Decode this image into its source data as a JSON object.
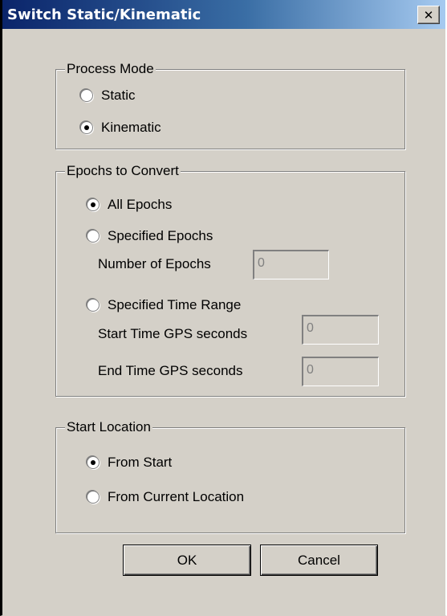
{
  "window": {
    "title": "Switch Static/Kinematic",
    "close_glyph": "✕"
  },
  "process_mode": {
    "legend": "Process Mode",
    "options": [
      {
        "label": "Static",
        "checked": false
      },
      {
        "label": "Kinematic",
        "checked": true
      }
    ]
  },
  "epochs": {
    "legend": "Epochs to Convert",
    "options": [
      {
        "label": "All Epochs",
        "checked": true
      },
      {
        "label": "Specified Epochs",
        "checked": false
      },
      {
        "label": "Specified Time Range",
        "checked": false
      }
    ],
    "number_of_epochs": {
      "label": "Number of Epochs",
      "value": "0"
    },
    "start_time": {
      "label": "Start Time GPS seconds",
      "value": "0"
    },
    "end_time": {
      "label": "End Time GPS seconds",
      "value": "0"
    }
  },
  "start_location": {
    "legend": "Start Location",
    "options": [
      {
        "label": "From Start",
        "checked": true
      },
      {
        "label": "From Current Location",
        "checked": false
      }
    ]
  },
  "buttons": {
    "ok": "OK",
    "cancel": "Cancel"
  }
}
